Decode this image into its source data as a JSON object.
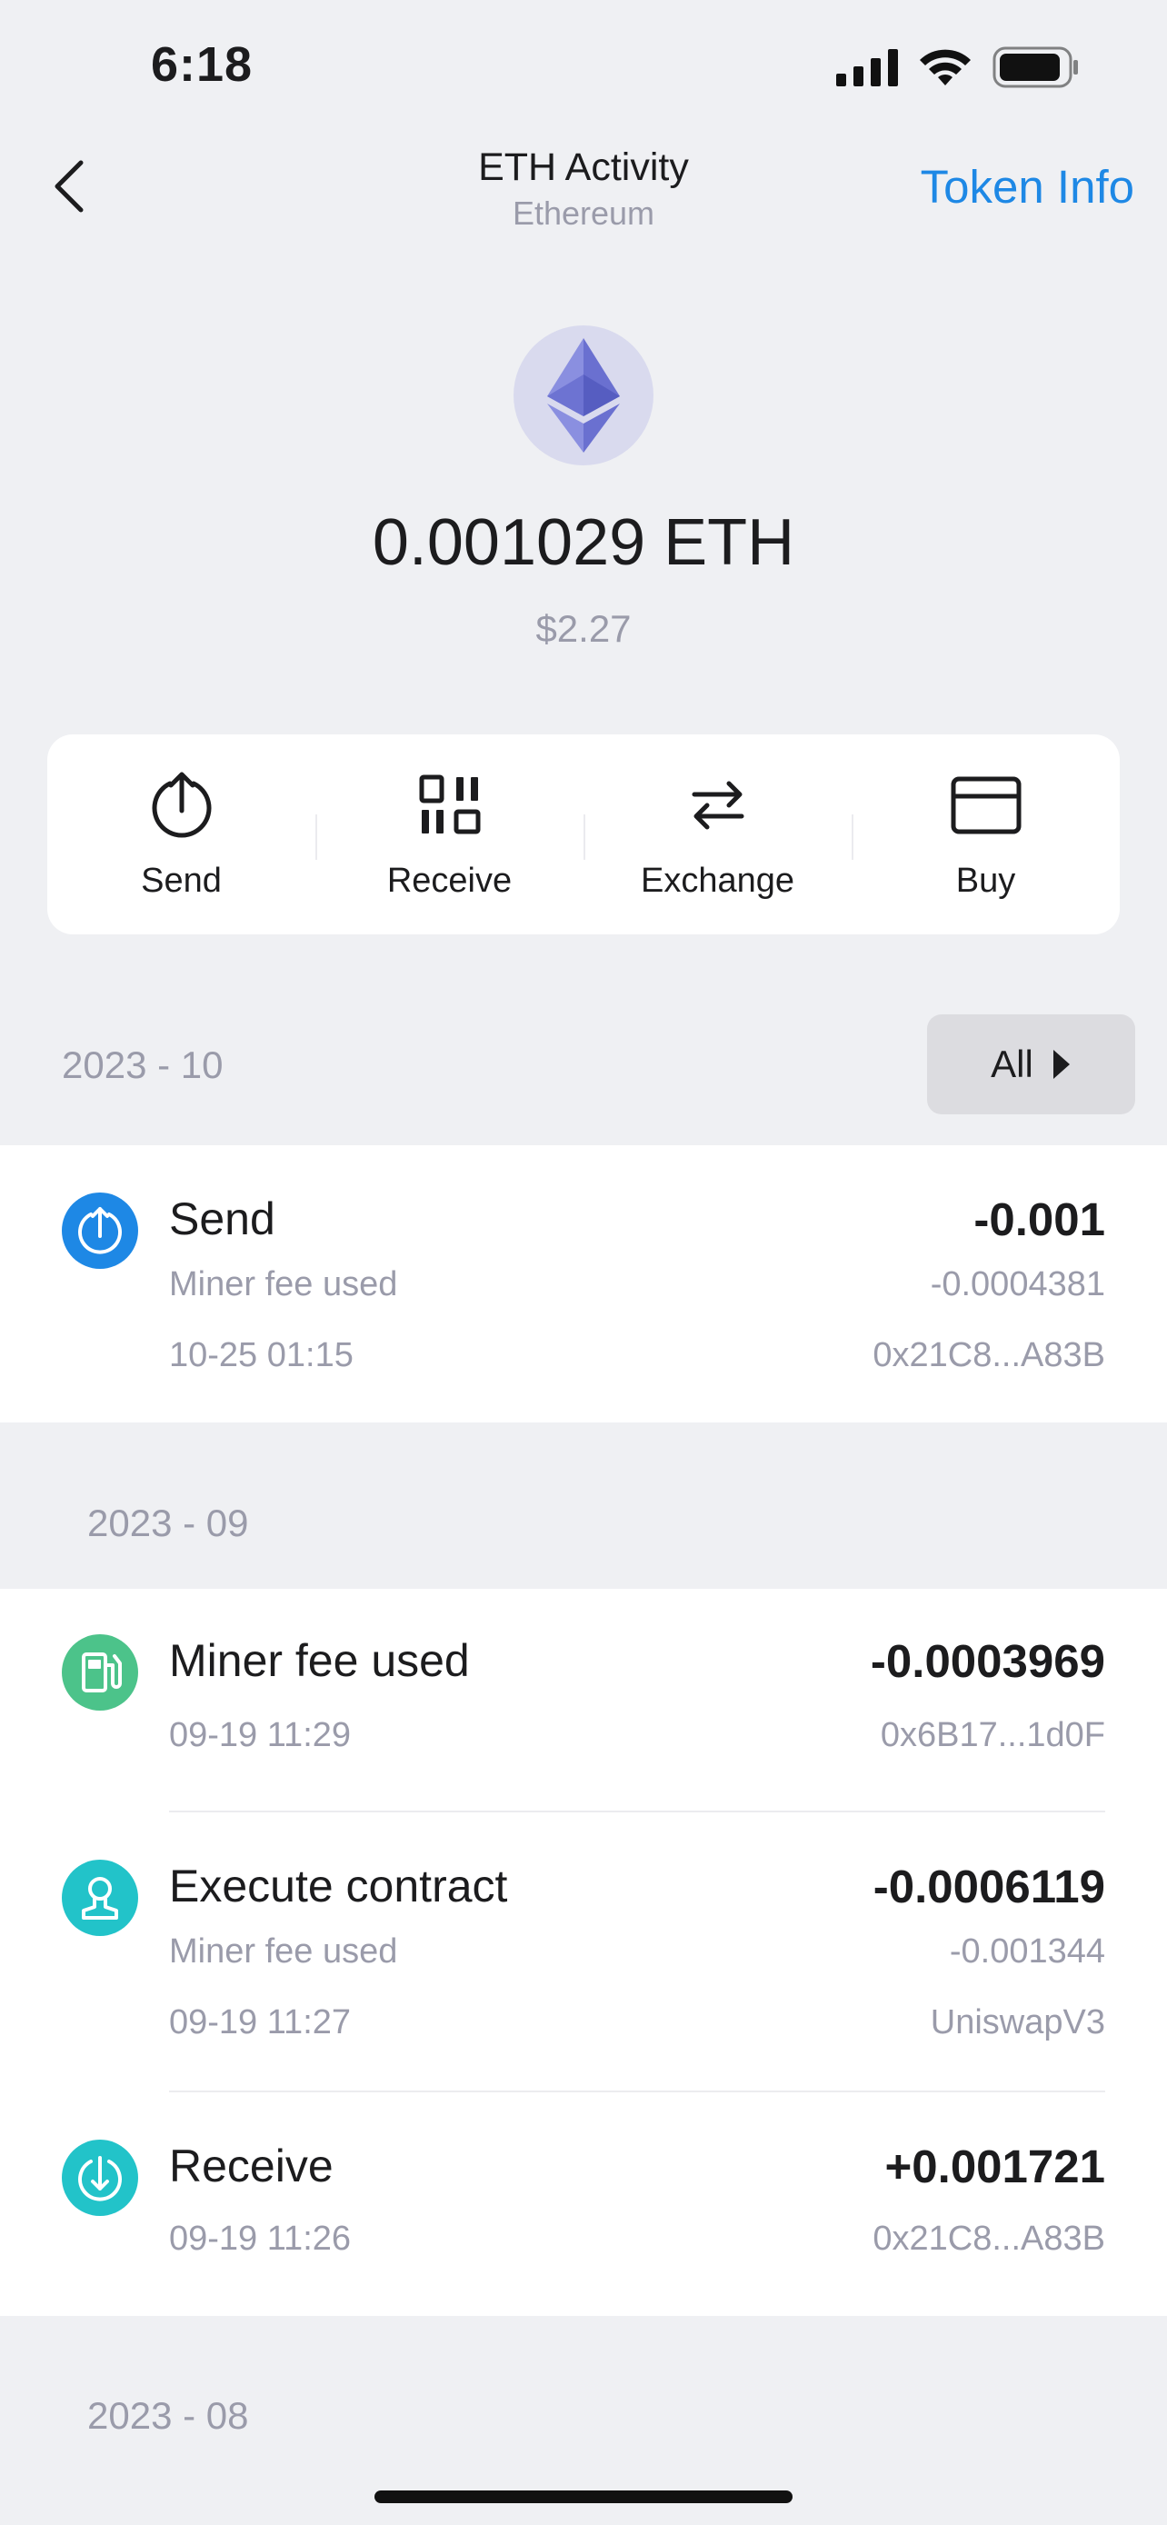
{
  "status": {
    "time": "6:18"
  },
  "nav": {
    "title": "ETH Activity",
    "subtitle": "Ethereum",
    "token_info": "Token Info"
  },
  "balance": {
    "amount": "0.001029 ETH",
    "fiat": "$2.27"
  },
  "actions": [
    {
      "label": "Send",
      "icon": "send-icon"
    },
    {
      "label": "Receive",
      "icon": "qr-icon"
    },
    {
      "label": "Exchange",
      "icon": "exchange-icon"
    },
    {
      "label": "Buy",
      "icon": "card-icon"
    }
  ],
  "filter": {
    "label": "All"
  },
  "sections": [
    {
      "header": "2023 - 10",
      "items": [
        {
          "title": "Send",
          "subtitle": "Miner fee used",
          "time": "10-25 01:15",
          "amount": "-0.001",
          "fee": "-0.0004381",
          "address": "0x21C8...A83B",
          "icon": "send-icon",
          "color": "#1E88E5"
        }
      ]
    },
    {
      "header": "2023 - 09",
      "items": [
        {
          "title": "Miner fee used",
          "time": "09-19 11:29",
          "amount": "-0.0003969",
          "address": "0x6B17...1d0F",
          "icon": "fuel-icon",
          "color": "#4CC38A"
        },
        {
          "title": "Execute contract",
          "subtitle": "Miner fee used",
          "time": "09-19 11:27",
          "amount": "-0.0006119",
          "fee": "-0.001344",
          "address": "UniswapV3",
          "icon": "contract-icon",
          "color": "#22C3C9"
        },
        {
          "title": "Receive",
          "time": "09-19 11:26",
          "amount": "+0.001721",
          "address": "0x21C8...A83B",
          "icon": "receive-icon",
          "color": "#22C3C9"
        }
      ]
    },
    {
      "header": "2023 - 08",
      "items": []
    }
  ]
}
